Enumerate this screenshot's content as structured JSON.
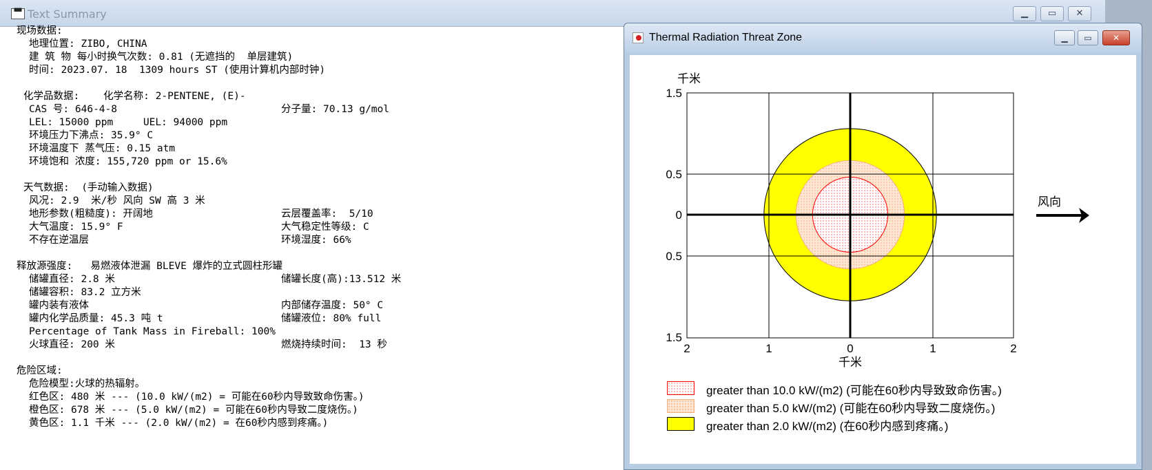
{
  "text_window": {
    "title": "Text Summary",
    "icon": "document-icon",
    "buttons": [
      "minimize",
      "maximize",
      "close"
    ],
    "lines": [
      {
        "text": "现场数据:",
        "indent": 0,
        "row": 0
      },
      {
        "text": "地理位置: ZIBO, CHINA",
        "indent": 1,
        "row": 1
      },
      {
        "text": "建 筑 物 每小时换气次数: 0.81 (无遮挡的  单层建筑)",
        "indent": 1,
        "row": 2
      },
      {
        "text": "时间: 2023.07. 18  1309 hours ST (使用计算机内部时钟)",
        "indent": 1,
        "row": 3
      },
      {
        "text": "化学品数据:    化学名称: 2-PENTENE, (E)-",
        "indent": 0.5,
        "row": 5
      },
      {
        "text": "CAS 号: 646-4-8",
        "indent": 1,
        "row": 6
      },
      {
        "text": "分子量: 70.13 g/mol",
        "indent": 2,
        "row": 6
      },
      {
        "text": "LEL: 15000 ppm     UEL: 94000 ppm",
        "indent": 1,
        "row": 7
      },
      {
        "text": "环境压力下沸点: 35.9° C",
        "indent": 1,
        "row": 8
      },
      {
        "text": "环境温度下 蒸气压: 0.15 atm",
        "indent": 1,
        "row": 9
      },
      {
        "text": "环境饱和 浓度: 155,720 ppm or 15.6%",
        "indent": 1,
        "row": 10
      },
      {
        "text": "天气数据:  (手动输入数据)",
        "indent": 0.5,
        "row": 12
      },
      {
        "text": "风况: 2.9  米/秒 风向 SW 高 3 米",
        "indent": 1,
        "row": 13
      },
      {
        "text": "地形参数(粗糙度): 开阔地",
        "indent": 1,
        "row": 14
      },
      {
        "text": "云层覆盖率:  5/10",
        "indent": 2,
        "row": 14
      },
      {
        "text": "大气温度: 15.9° F",
        "indent": 1,
        "row": 15
      },
      {
        "text": "大气稳定性等级: C",
        "indent": 2,
        "row": 15
      },
      {
        "text": "不存在逆温层",
        "indent": 1,
        "row": 16
      },
      {
        "text": "环境湿度: 66%",
        "indent": 2,
        "row": 16
      },
      {
        "text": "释放源强度:   易燃液体泄漏 BLEVE 爆炸的立式圆柱形罐",
        "indent": 0,
        "row": 18
      },
      {
        "text": "储罐直径: 2.8 米",
        "indent": 1,
        "row": 19
      },
      {
        "text": "储罐长度(高):13.512 米",
        "indent": 2,
        "row": 19
      },
      {
        "text": "储罐容积: 83.2 立方米",
        "indent": 1,
        "row": 20
      },
      {
        "text": "罐内装有液体",
        "indent": 1,
        "row": 21
      },
      {
        "text": "内部储存温度: 50° C",
        "indent": 2,
        "row": 21
      },
      {
        "text": "罐内化学品质量: 45.3 吨 t",
        "indent": 1,
        "row": 22
      },
      {
        "text": "储罐液位: 80% full",
        "indent": 2,
        "row": 22
      },
      {
        "text": "Percentage of Tank Mass in Fireball: 100%",
        "indent": 1,
        "row": 23
      },
      {
        "text": "火球直径: 200 米",
        "indent": 1,
        "row": 24
      },
      {
        "text": "燃烧持续时间:  13 秒",
        "indent": 2,
        "row": 24
      },
      {
        "text": "危险区域:",
        "indent": 0,
        "row": 26
      },
      {
        "text": "危险模型:火球的热辐射。",
        "indent": 1,
        "row": 27
      },
      {
        "text": "红色区: 480 米 --- (10.0 kW/(m2) = 可能在60秒内导致致命伤害。)",
        "indent": 1,
        "row": 28
      },
      {
        "text": "橙色区: 678 米 --- (5.0 kW/(m2) = 可能在60秒内导致二度烧伤。)",
        "indent": 1,
        "row": 29
      },
      {
        "text": "黄色区: 1.1 千米 --- (2.0 kW/(m2) = 在60秒内感到疼痛。)",
        "indent": 1,
        "row": 30
      }
    ]
  },
  "threat_window": {
    "title": "Thermal Radiation Threat Zone",
    "icon": "fire-icon",
    "buttons": [
      "minimize",
      "maximize",
      "close"
    ],
    "plot": {
      "y_unit_label": "千米",
      "x_unit_label": "千米",
      "y_ticks": [
        "1.5",
        "0.5",
        "0",
        "0.5",
        "1.5"
      ],
      "x_ticks": [
        "2",
        "1",
        "0",
        "1",
        "2"
      ],
      "wind_label": "风向",
      "zones_km": {
        "red": 0.48,
        "orange": 0.678,
        "yellow": 1.1
      },
      "colors": {
        "red": "#ff0000",
        "orange": "#f7c8a0",
        "yellow": "#ffff00",
        "orange_fill": "#fde7d4"
      }
    },
    "legend": [
      {
        "label": "greater than 10.0 kW/(m2) (可能在60秒内导致致命伤害。)",
        "swatch": "red-dotted"
      },
      {
        "label": "greater than 5.0 kW/(m2) (可能在60秒内导致二度烧伤。)",
        "swatch": "orange-dotted"
      },
      {
        "label": "greater than 2.0 kW/(m2) (在60秒内感到疼痛。)",
        "swatch": "yellow-solid"
      }
    ]
  }
}
